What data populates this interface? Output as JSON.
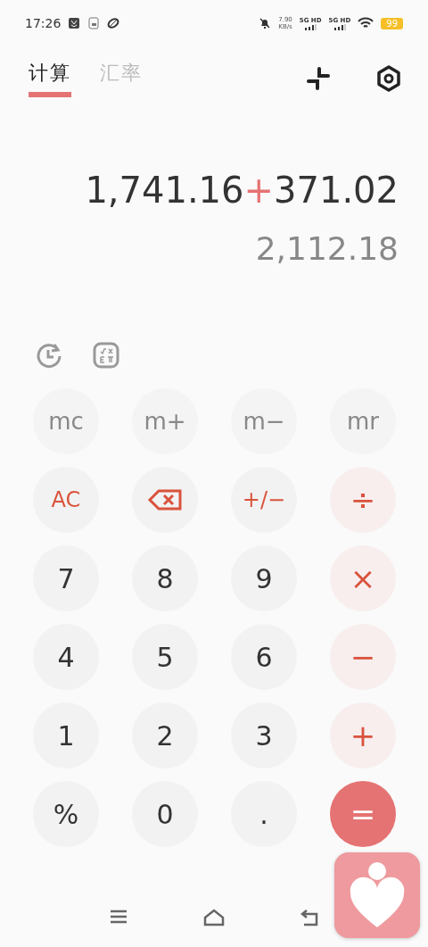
{
  "status_bar": {
    "time": "17:26",
    "speed": "7.90",
    "speed_unit": "KB/s",
    "networks": [
      "5G HD",
      "5G HD"
    ],
    "battery": "99"
  },
  "tabs": [
    {
      "label": "计算",
      "selected": true
    },
    {
      "label": "汇率",
      "selected": false
    }
  ],
  "display": {
    "expression": [
      {
        "kind": "number",
        "text": "1,741.16"
      },
      {
        "kind": "operator",
        "text": "+"
      },
      {
        "kind": "number",
        "text": "371.02"
      }
    ],
    "result": "2,112.18"
  },
  "keys": [
    {
      "label": "mc",
      "kind": "memory"
    },
    {
      "label": "m+",
      "kind": "memory"
    },
    {
      "label": "m−",
      "kind": "memory"
    },
    {
      "label": "mr",
      "kind": "memory"
    },
    {
      "label": "AC",
      "kind": "function"
    },
    {
      "kind": "backspace"
    },
    {
      "label": "+/−",
      "kind": "function"
    },
    {
      "label": "÷",
      "kind": "operator"
    },
    {
      "label": "7",
      "kind": "digit"
    },
    {
      "label": "8",
      "kind": "digit"
    },
    {
      "label": "9",
      "kind": "digit"
    },
    {
      "label": "×",
      "kind": "operator"
    },
    {
      "label": "4",
      "kind": "digit"
    },
    {
      "label": "5",
      "kind": "digit"
    },
    {
      "label": "6",
      "kind": "digit"
    },
    {
      "label": "−",
      "kind": "operator"
    },
    {
      "label": "1",
      "kind": "digit"
    },
    {
      "label": "2",
      "kind": "digit"
    },
    {
      "label": "3",
      "kind": "digit"
    },
    {
      "label": "+",
      "kind": "operator"
    },
    {
      "label": "%",
      "kind": "digit"
    },
    {
      "label": "0",
      "kind": "digit"
    },
    {
      "label": ".",
      "kind": "digit"
    },
    {
      "label": "=",
      "kind": "equals"
    }
  ]
}
